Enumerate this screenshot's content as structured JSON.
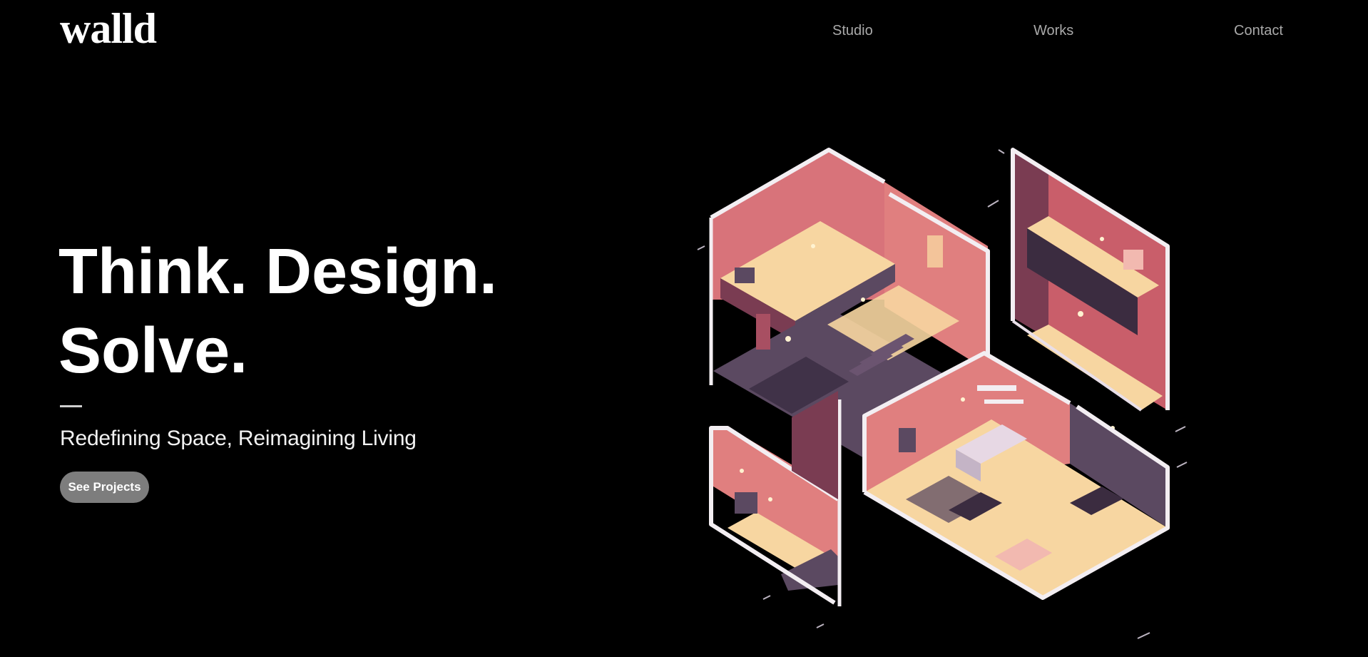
{
  "header": {
    "logo_text": "walld",
    "nav": [
      "Studio",
      "Works",
      "Contact"
    ]
  },
  "hero": {
    "title_line1": "Think. Design.",
    "title_line2": "Solve.",
    "subtitle": "Redefining Space, Reimagining Living",
    "cta_label": "See Projects"
  },
  "illustration": {
    "subject": "isometric cutaway interior rooms",
    "palette": {
      "wall_light": "#f28a86",
      "wall_mid": "#c95e6a",
      "wall_dark": "#7a3c52",
      "floor": "#f7d6a1",
      "floor_shadow": "#5b4961",
      "frame": "#f3eef2",
      "dark": "#2a2030"
    }
  },
  "colors": {
    "background": "#000000",
    "nav_text": "#a9a9a9",
    "button_bg": "#7d7d7d"
  }
}
